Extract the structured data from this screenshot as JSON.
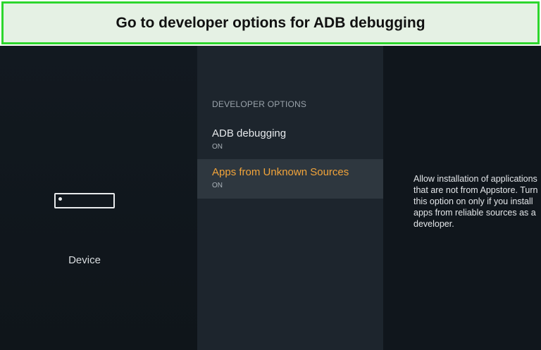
{
  "banner": {
    "title": "Go to developer options for ADB debugging"
  },
  "colors": {
    "banner_border": "#2dd62d",
    "banner_background": "#e5f1e4",
    "highlight_text": "#f2a43a",
    "selected_row": "#2e373f"
  },
  "sidebar": {
    "device_label": "Device",
    "icon": "device-icon"
  },
  "developer_options": {
    "header": "DEVELOPER OPTIONS",
    "items": [
      {
        "title": "ADB debugging",
        "status": "ON"
      },
      {
        "title": "Apps from Unknown Sources",
        "status": "ON"
      }
    ]
  },
  "detail": {
    "description": "Allow installation of applications that are not from Appstore. Turn this option on only if you install apps from reliable sources as a developer."
  }
}
